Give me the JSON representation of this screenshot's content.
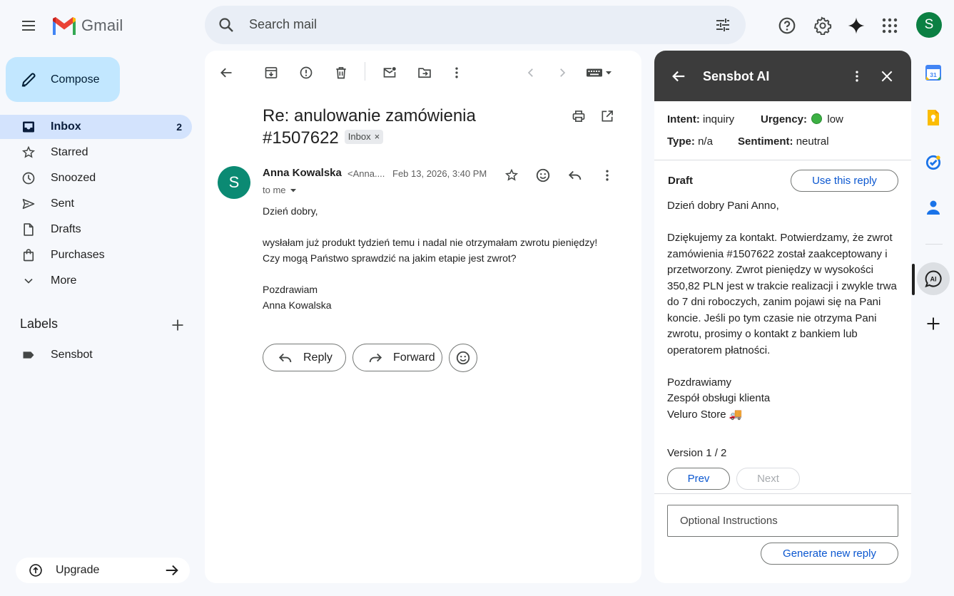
{
  "app": {
    "name": "Gmail"
  },
  "search": {
    "placeholder": "Search mail"
  },
  "user": {
    "initial": "S"
  },
  "nav": {
    "compose": "Compose",
    "items": [
      {
        "label": "Inbox",
        "count": "2"
      },
      {
        "label": "Starred"
      },
      {
        "label": "Snoozed"
      },
      {
        "label": "Sent"
      },
      {
        "label": "Drafts"
      },
      {
        "label": "Purchases"
      },
      {
        "label": "More"
      }
    ],
    "labels_title": "Labels",
    "labels": [
      {
        "label": "Sensbot"
      }
    ],
    "upgrade": "Upgrade"
  },
  "email": {
    "subject": "Re: anulowanie zamówienia #1507622",
    "chip": "Inbox",
    "chip_close": "×",
    "sender_initial": "S",
    "sender_name": "Anna Kowalska",
    "sender_email": "<Anna....",
    "date": "Feb 13, 2026, 3:40 PM",
    "to": "to me",
    "body": [
      "Dzień dobry,",
      "",
      "wysłałam już produkt tydzień temu i nadal nie otrzymałam zwrotu pieniędzy!",
      "Czy mogą Państwo sprawdzić na jakim etapie jest zwrot?",
      "",
      "Pozdrawiam",
      "Anna Kowalska"
    ],
    "reply": "Reply",
    "forward": "Forward"
  },
  "sensbot": {
    "title": "Sensbot AI",
    "intent_label": "Intent:",
    "intent": "inquiry",
    "urgency_label": "Urgency:",
    "urgency": "low",
    "type_label": "Type:",
    "type": "n/a",
    "sentiment_label": "Sentiment:",
    "sentiment": "neutral",
    "draft_label": "Draft",
    "use_reply": "Use this reply",
    "draft": [
      "Dzień dobry Pani Anno,",
      "",
      "Dziękujemy za kontakt. Potwierdzamy, że zwrot zamówienia #1507622 został zaakceptowany i przetworzony. Zwrot pieniędzy w wysokości 350,82 PLN jest w trakcie realizacji i zwykle trwa do 7 dni roboczych, zanim pojawi się na Pani koncie. Jeśli po tym czasie nie otrzyma Pani zwrotu, prosimy o kontakt z bankiem lub operatorem płatności.",
      "",
      "Pozdrawiamy",
      "Zespół obsługi klienta",
      "Veluro Store 🚚"
    ],
    "version": "Version 1 / 2",
    "prev": "Prev",
    "next": "Next",
    "instructions_placeholder": "Optional Instructions",
    "generate": "Generate new reply"
  },
  "colors": {
    "compose_bg": "#c2e7ff",
    "nav_active_bg": "#d3e3fd",
    "sensbot_header": "#3c3c3c",
    "link_blue": "#0b57d0",
    "urgency_low": "#3cb043",
    "avatar_green": "#0b8043",
    "sender_avatar": "#0b8a73"
  }
}
